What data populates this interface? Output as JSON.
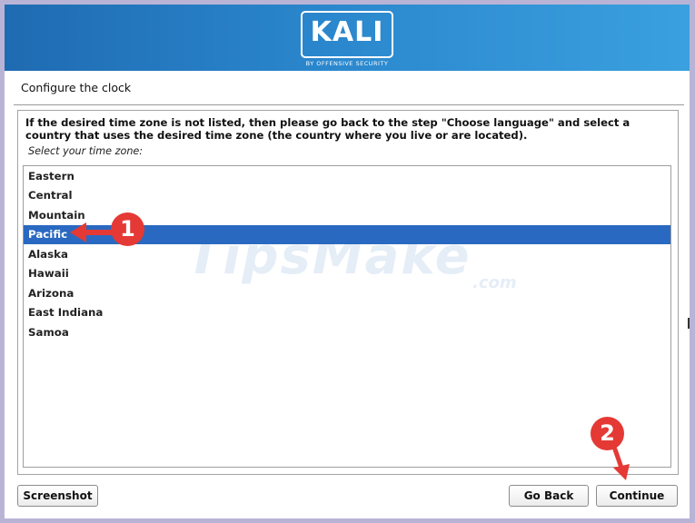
{
  "banner": {
    "logo_text": "KALI",
    "logo_subtitle": "BY OFFENSIVE SECURITY"
  },
  "page": {
    "title": "Configure the clock"
  },
  "main": {
    "help_text": "If the desired time zone is not listed, then please go back to the step \"Choose language\" and select a country that uses the desired time zone (the country where you live or are located).",
    "select_label": "Select your time zone:",
    "timezones": [
      "Eastern",
      "Central",
      "Mountain",
      "Pacific",
      "Alaska",
      "Hawaii",
      "Arizona",
      "East Indiana",
      "Samoa"
    ],
    "selected_timezone": "Pacific"
  },
  "buttons": {
    "screenshot": "Screenshot",
    "go_back": "Go Back",
    "continue": "Continue"
  },
  "annotations": {
    "marker_1": "1",
    "marker_2": "2",
    "color": "#e53935"
  },
  "watermark": {
    "text": "TipsMake",
    "domain": ".com"
  },
  "colors": {
    "selection": "#2a69c1",
    "banner": "#2a86cc"
  }
}
